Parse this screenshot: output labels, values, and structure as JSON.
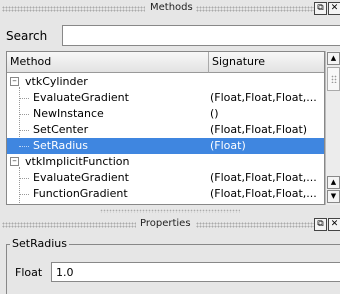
{
  "methods_panel": {
    "title": "Methods",
    "search_label": "Search",
    "search_value": "",
    "columns": [
      "Method",
      "Signature"
    ],
    "rows": [
      {
        "name": "vtkCylinder",
        "signature": "",
        "group": true
      },
      {
        "name": "EvaluateGradient",
        "signature": "(Float,Float,Float,..."
      },
      {
        "name": "NewInstance",
        "signature": "()"
      },
      {
        "name": "SetCenter",
        "signature": "(Float,Float,Float)"
      },
      {
        "name": "SetRadius",
        "signature": "(Float)",
        "selected": true
      },
      {
        "name": "vtkImplicitFunction",
        "signature": "",
        "group": true
      },
      {
        "name": "EvaluateGradient",
        "signature": "(Float,Float,Float,..."
      },
      {
        "name": "FunctionGradient",
        "signature": "(Float,Float,Float,..."
      }
    ]
  },
  "properties_panel": {
    "title": "Properties",
    "group_title": "SetRadius",
    "param_label": "Float",
    "param_value": "1.0"
  },
  "icons": {
    "float": "float-icon",
    "close": "close-icon",
    "expander": "tree-collapse-icon",
    "scroll_up": "scroll-up-icon",
    "scroll_down": "scroll-down-icon"
  },
  "colors": {
    "selection": "#3f86e0",
    "panel_bg": "#e6e6e6"
  }
}
